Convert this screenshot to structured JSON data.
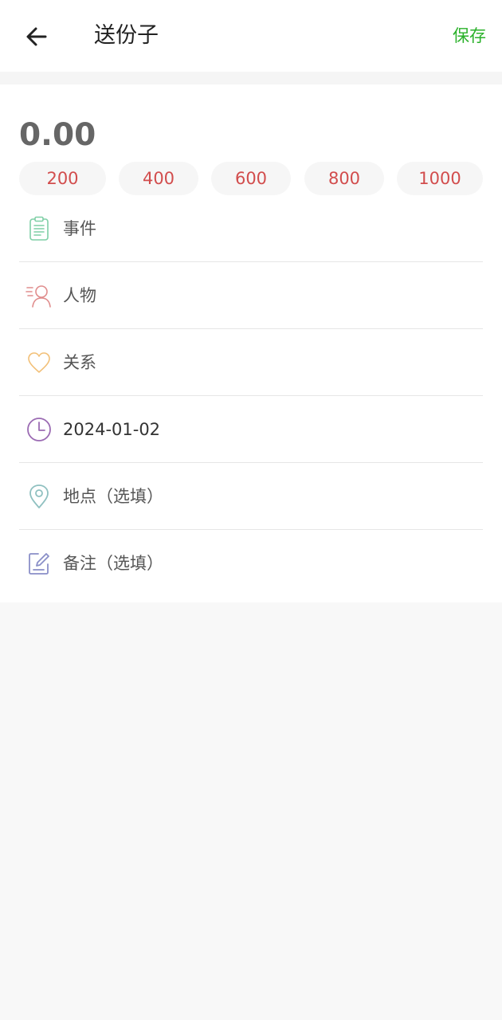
{
  "header": {
    "title": "送份子",
    "save_label": "保存",
    "save_color": "#2ab12a",
    "back_icon": "arrow-left-icon"
  },
  "amount": {
    "value": "0.00"
  },
  "quick_amounts": {
    "color": "#d24d4d",
    "items": [
      "200",
      "400",
      "600",
      "800",
      "1000"
    ]
  },
  "form": {
    "event": {
      "label": "事件",
      "icon": "clipboard-icon",
      "icon_color": "#7fcfa6"
    },
    "person": {
      "label": "人物",
      "icon": "person-icon",
      "icon_color": "#e08d8d"
    },
    "relation": {
      "label": "关系",
      "icon": "heart-icon",
      "icon_color": "#f2c078"
    },
    "date": {
      "value": "2024-01-02",
      "icon": "clock-icon",
      "icon_color": "#9b6bb3"
    },
    "location": {
      "placeholder": "地点（选填）",
      "icon": "location-pin-icon",
      "icon_color": "#8fc0c0"
    },
    "note": {
      "placeholder": "备注（选填）",
      "icon": "edit-note-icon",
      "icon_color": "#8a8fc8"
    }
  }
}
